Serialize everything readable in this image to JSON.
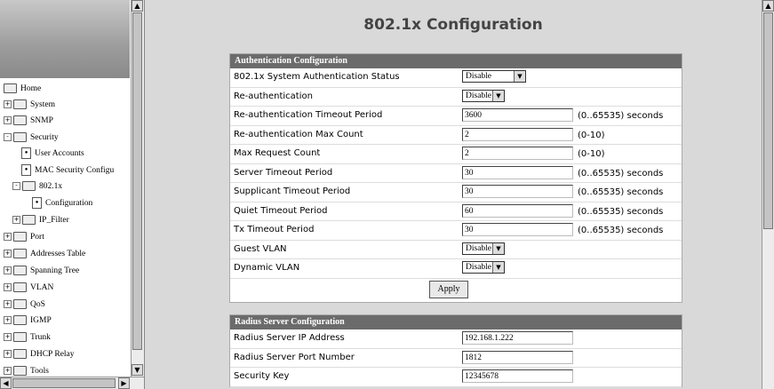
{
  "sidebar": {
    "items": [
      {
        "label": "Home",
        "icon": "folder-open-icon",
        "expand": ""
      },
      {
        "label": "System",
        "icon": "folder-icon",
        "expand": "+"
      },
      {
        "label": "SNMP",
        "icon": "folder-icon",
        "expand": "+"
      },
      {
        "label": "Security",
        "icon": "folder-open-icon",
        "expand": "-"
      },
      {
        "label": "User Accounts",
        "icon": "page-icon",
        "expand": ""
      },
      {
        "label": "MAC Security Configu",
        "icon": "page-icon",
        "expand": ""
      },
      {
        "label": "802.1x",
        "icon": "folder-open-icon",
        "expand": "-"
      },
      {
        "label": "Configuration",
        "icon": "page-icon",
        "expand": ""
      },
      {
        "label": "IP_Filter",
        "icon": "folder-icon",
        "expand": "+"
      },
      {
        "label": "Port",
        "icon": "folder-icon",
        "expand": "+"
      },
      {
        "label": "Addresses Table",
        "icon": "folder-icon",
        "expand": "+"
      },
      {
        "label": "Spanning Tree",
        "icon": "folder-icon",
        "expand": "+"
      },
      {
        "label": "VLAN",
        "icon": "folder-icon",
        "expand": "+"
      },
      {
        "label": "QoS",
        "icon": "folder-icon",
        "expand": "+"
      },
      {
        "label": "IGMP",
        "icon": "folder-icon",
        "expand": "+"
      },
      {
        "label": "Trunk",
        "icon": "folder-icon",
        "expand": "+"
      },
      {
        "label": "DHCP Relay",
        "icon": "folder-icon",
        "expand": "+"
      },
      {
        "label": "Tools",
        "icon": "folder-icon",
        "expand": "+"
      }
    ]
  },
  "page": {
    "title": "802.1x Configuration"
  },
  "auth": {
    "header": "Authentication Configuration",
    "rows": [
      {
        "label": "802.1x System Authentication Status",
        "type": "select",
        "value": "Disable",
        "unit": ""
      },
      {
        "label": "Re-authentication",
        "type": "select",
        "value": "Disable",
        "unit": ""
      },
      {
        "label": "Re-authentication Timeout Period",
        "type": "text",
        "value": "3600",
        "unit": "(0..65535) seconds"
      },
      {
        "label": "Re-authentication Max Count",
        "type": "text",
        "value": "2",
        "unit": "(0-10)"
      },
      {
        "label": "Max Request Count",
        "type": "text",
        "value": "2",
        "unit": "(0-10)"
      },
      {
        "label": "Server Timeout Period",
        "type": "text",
        "value": "30",
        "unit": "(0..65535) seconds"
      },
      {
        "label": "Supplicant Timeout Period",
        "type": "text",
        "value": "30",
        "unit": "(0..65535) seconds"
      },
      {
        "label": "Quiet Timeout Period",
        "type": "text",
        "value": "60",
        "unit": "(0..65535) seconds"
      },
      {
        "label": "Tx Timeout Period",
        "type": "text",
        "value": "30",
        "unit": "(0..65535) seconds"
      },
      {
        "label": "Guest VLAN",
        "type": "select",
        "value": "Disable",
        "unit": ""
      },
      {
        "label": "Dynamic VLAN",
        "type": "select",
        "value": "Disable",
        "unit": ""
      }
    ],
    "apply_label": "Apply"
  },
  "radius": {
    "header": "Radius Server Configuration",
    "rows": [
      {
        "label": "Radius Server IP Address",
        "value": "192.168.1.222"
      },
      {
        "label": "Radius Server Port Number",
        "value": "1812"
      },
      {
        "label": "Security Key",
        "value": "12345678"
      }
    ]
  }
}
